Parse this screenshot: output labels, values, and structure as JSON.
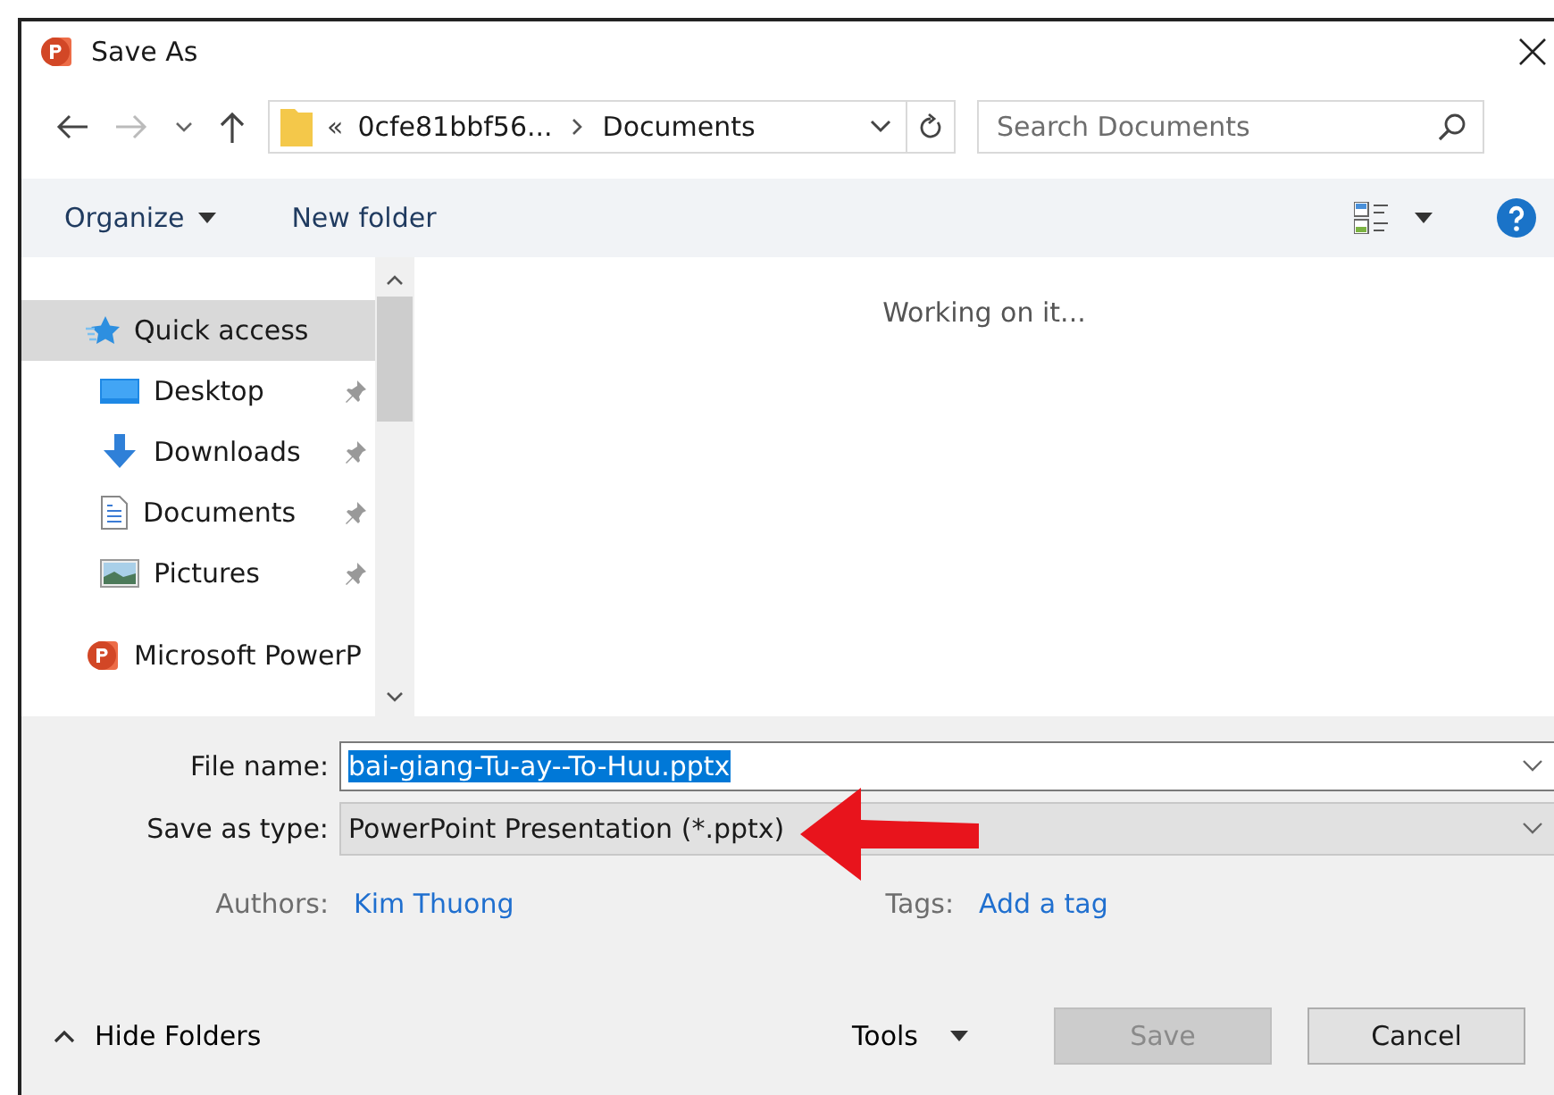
{
  "window": {
    "title": "Save As"
  },
  "address": {
    "prefix": "«",
    "path": [
      "0cfe81bbf56...",
      "Documents"
    ]
  },
  "search": {
    "placeholder": "Search Documents"
  },
  "toolbar": {
    "organize": "Organize",
    "new_folder": "New folder"
  },
  "sidebar": {
    "items": [
      {
        "label": "Quick access",
        "kind": "star",
        "selected": true,
        "children": [
          {
            "label": "Desktop",
            "kind": "desktop",
            "pinned": true,
            "selected": false
          },
          {
            "label": "Downloads",
            "kind": "download",
            "pinned": true,
            "selected": false
          },
          {
            "label": "Documents",
            "kind": "document",
            "pinned": true,
            "selected": false
          },
          {
            "label": "Pictures",
            "kind": "pictures",
            "pinned": true,
            "selected": false
          }
        ]
      },
      {
        "label": "Microsoft PowerP",
        "kind": "powerpoint",
        "selected": false
      }
    ]
  },
  "content": {
    "status": "Working on it..."
  },
  "form": {
    "file_name": {
      "label": "File name:",
      "value": "bai-giang-Tu-ay--To-Huu.pptx",
      "highlighted": true
    },
    "save_as_type": {
      "label": "Save as type:",
      "value": "PowerPoint Presentation (*.pptx)"
    },
    "authors": {
      "label": "Authors:",
      "value": "Kim Thuong"
    },
    "tags": {
      "label": "Tags:",
      "value": "Add a tag"
    }
  },
  "footer": {
    "hide_folders": "Hide Folders",
    "tools": "Tools",
    "buttons": [
      {
        "label": "Save",
        "disabled": true
      },
      {
        "label": "Cancel",
        "disabled": false
      }
    ]
  },
  "annotations": [
    {
      "kind": "arrow"
    }
  ]
}
